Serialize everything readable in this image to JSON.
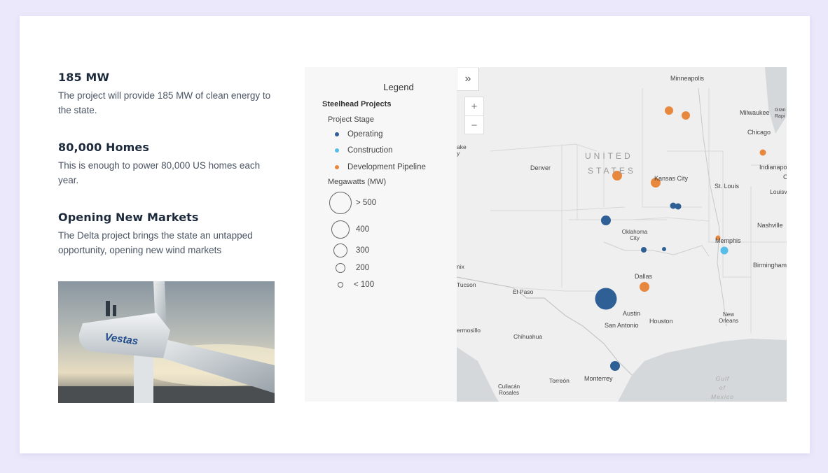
{
  "highlights": [
    {
      "title": "185 MW",
      "body": "The project will provide 185 MW of clean energy to the state."
    },
    {
      "title": "80,000 Homes",
      "body": "This is enough to power 80,000 US homes each year."
    },
    {
      "title": "Opening New Markets",
      "body": "The Delta project brings the state an untapped opportunity, opening new wind markets"
    }
  ],
  "photo": {
    "brand_text": "Vestas"
  },
  "legend": {
    "title": "Legend",
    "group": "Steelhead Projects",
    "stage_label": "Project Stage",
    "stages": [
      {
        "label": "Operating",
        "color": "#2e6096"
      },
      {
        "label": "Construction",
        "color": "#55bde8"
      },
      {
        "label": "Development Pipeline",
        "color": "#e8883e"
      }
    ],
    "size_label": "Megawatts (MW)",
    "sizes": [
      {
        "label": "> 500",
        "level": 500
      },
      {
        "label": "400",
        "level": 400
      },
      {
        "label": "300",
        "level": 300
      },
      {
        "label": "200",
        "level": 200
      },
      {
        "label": "< 100",
        "level": 100
      }
    ]
  },
  "map": {
    "expand_icon": "double-chevron-right",
    "zoom_in": "+",
    "zoom_out": "−",
    "country_line1": "UNITED",
    "country_line2": "STATES",
    "gulf": "Gulf\nof\nMexico",
    "cities": {
      "minneapolis": "Minneapolis",
      "milwaukee": "Milwaukee",
      "chicago": "Chicago",
      "denver": "Denver",
      "kansas_city": "Kansas City",
      "st_louis": "St. Louis",
      "indianapolis": "Indianapo",
      "louisville": "Louisv",
      "nashville": "Nashville",
      "oklahoma_city": "Oklahoma City",
      "memphis": "Memphis",
      "birmingham": "Birmingham",
      "dallas": "Dallas",
      "el_paso": "El Paso",
      "tucson": "Tucson",
      "phoenix": "nix",
      "salt_lake": "ake\ny",
      "austin": "Austin",
      "san_antonio": "San Antonio",
      "houston": "Houston",
      "new_orleans": "New\nOrleans",
      "hermosillo": "ermosillo",
      "chihuahua": "Chihuahua",
      "torreon": "Torreón",
      "monterrey": "Monterrey",
      "culiacan": "Culiacán\nRosales",
      "gran_rapids": "Gran\nRapi",
      "c": "C"
    }
  }
}
